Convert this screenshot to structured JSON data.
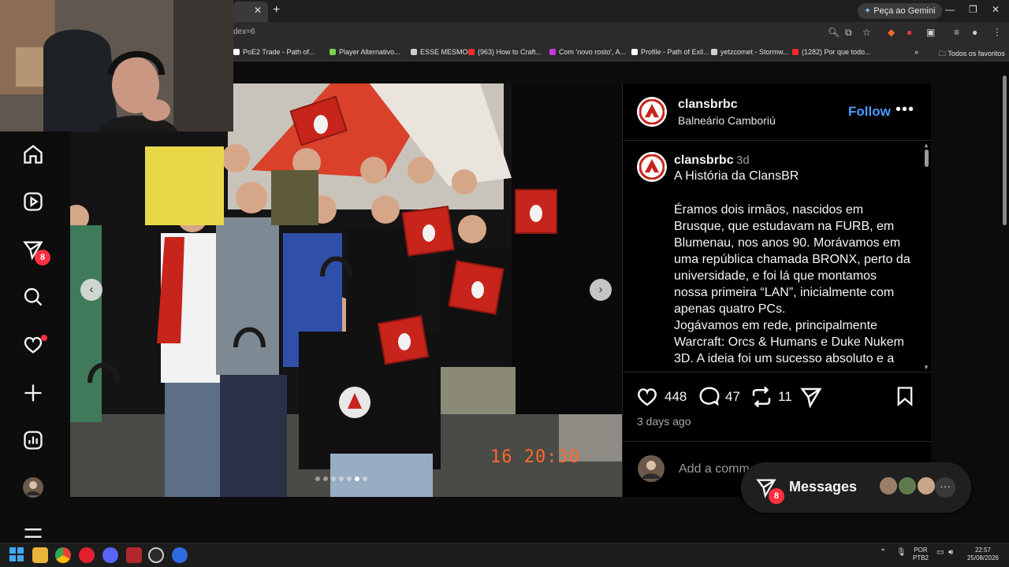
{
  "browser": {
    "gemini_label": "Peça ao Gemini",
    "url_fragment": "dex=6",
    "bookmarks": [
      "PoE2 Trade - Path of...",
      "Player Alternativo...",
      "ESSE MESMO",
      "(963) How to Craft...",
      "Com 'novo rosto', A...",
      "Profile - Path of Exil...",
      "yetzcomet - Stormw...",
      "(1282) Por que todo..."
    ],
    "all_favorites": "Todos os favoritos",
    "bookmark_colors": [
      "#ffffff",
      "#7bd34a",
      "#d0d0d0",
      "#ff2a2a",
      "#c23bd4",
      "#ffffff",
      "#d0d0d0",
      "#ff2a2a"
    ]
  },
  "instagram": {
    "nav_items": [
      "home-icon",
      "reels-icon",
      "direct-icon",
      "search-icon",
      "heart-icon",
      "create-icon",
      "insights-icon",
      "profile-avatar",
      "menu-icon"
    ],
    "direct_badge": "8",
    "post": {
      "username": "clansbrbc",
      "location": "Balneário Camboriú",
      "follow_label": "Follow",
      "caption_user": "clansbrbc",
      "caption_time": "3d",
      "caption_title": "A História da ClansBR",
      "caption_body": "Éramos dois irmãos, nascidos em Brusque, que estudavam na FURB, em Blumenau, nos anos 90. Morávamos em uma república chamada BRONX, perto da universidade, e foi lá que montamos nossa primeira “LAN”, inicialmente com apenas quatro PCs.\nJogávamos em rede, principalmente Warcraft: Orcs & Humans e Duke Nukem 3D. A ideia foi um sucesso absoluto e a",
      "likes": "448",
      "comments": "47",
      "reposts": "11",
      "posted_ago": "3 days ago",
      "comment_placeholder": "Add a comm",
      "photo_timestamp": "16 20:30",
      "carousel_dots": 7,
      "carousel_active": 5
    },
    "messages": {
      "label": "Messages",
      "badge": "8"
    }
  },
  "taskbar": {
    "lang_top": "POR",
    "lang_bottom": "PTB2",
    "time": "22:57",
    "date": "25/08/2026"
  }
}
